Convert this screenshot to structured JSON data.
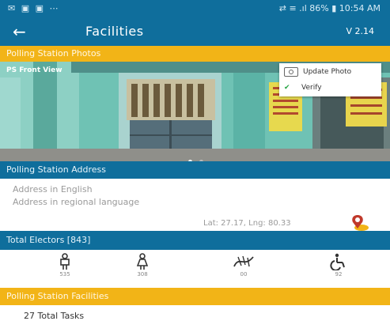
{
  "status_bar": {
    "left_icons": "✉ ▣ ▣ ⋯",
    "right_text": "⇄ ≡ .ıl 86% ▮ 10:54 AM"
  },
  "app_bar": {
    "back_icon": "←",
    "title": "Facilities",
    "version": "V 2.14"
  },
  "photos_section": {
    "header": "Polling Station Photos",
    "caption": "PS Front View",
    "update_photo": "Update Photo",
    "verify": "Verify",
    "dot_colors": [
      "#ffffff",
      "#bcbcbc"
    ]
  },
  "address_section": {
    "header": "Polling Station Address",
    "line1": "Address in English",
    "line2": "Address in regional language",
    "latlng": "Lat: 27.17, Lng: 80.33"
  },
  "electors": {
    "header": "Total Electors [843]",
    "items": [
      {
        "icon": "male-icon",
        "count": "535"
      },
      {
        "icon": "female-icon",
        "count": "308"
      },
      {
        "icon": "third-gender-icon",
        "count": "00"
      },
      {
        "icon": "wheelchair-icon",
        "count": "92"
      }
    ]
  },
  "facilities_section": {
    "header": "Polling Station Facilities",
    "total_tasks": "27 Total Tasks"
  },
  "colors": {
    "primary_blue": "#0f6e9c",
    "accent_yellow": "#f2b417",
    "verify_green": "#26a544"
  }
}
